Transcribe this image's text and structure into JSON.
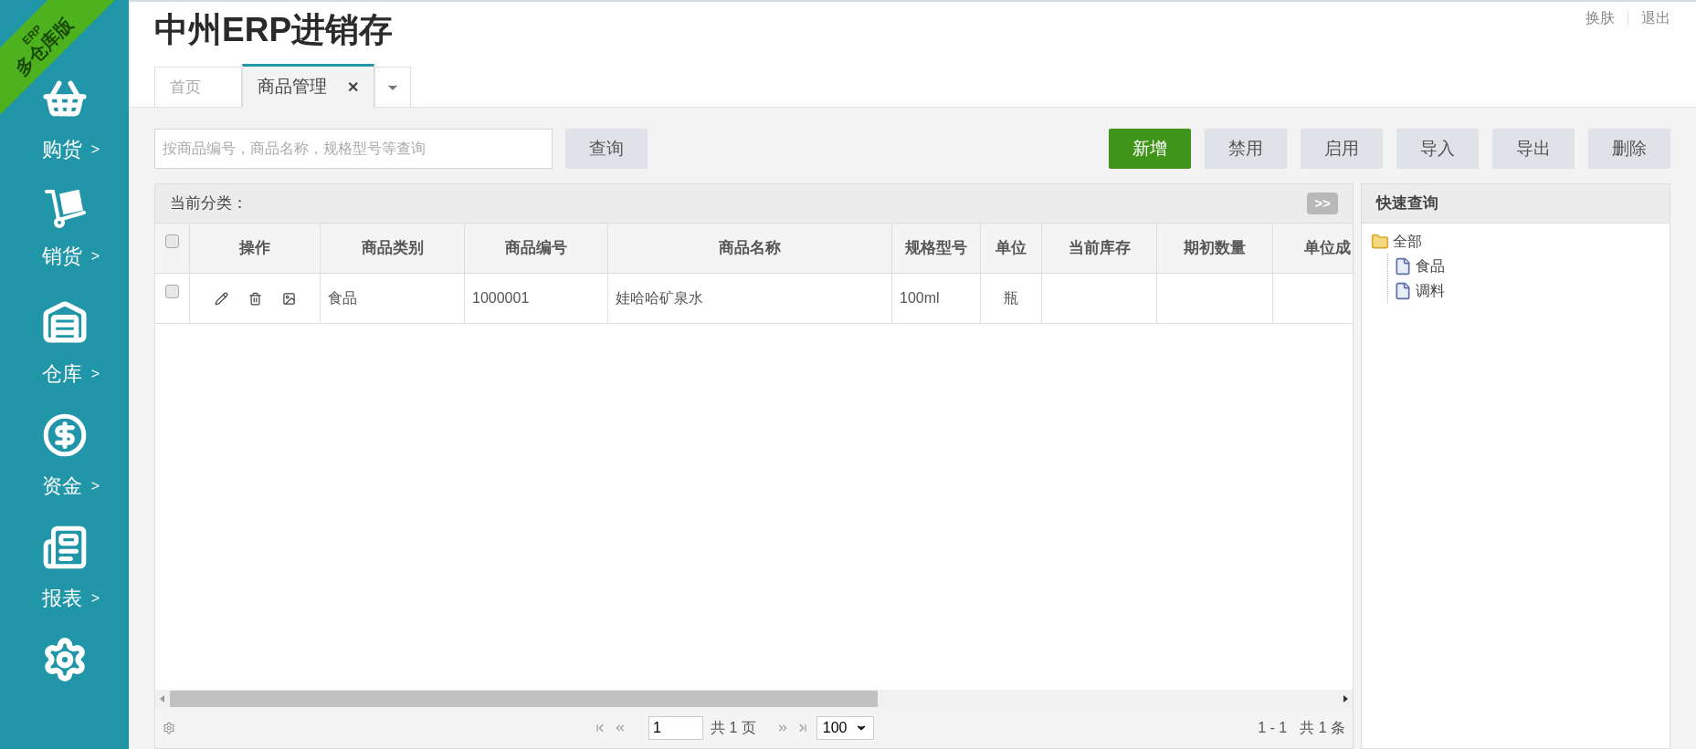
{
  "ribbon": {
    "small": "ERP",
    "large": "多仓库版"
  },
  "sidebar": {
    "items": [
      {
        "kind": "basket",
        "label": "购货",
        "arrow": ">"
      },
      {
        "kind": "cart",
        "label": "销货",
        "arrow": ">"
      },
      {
        "kind": "warehouse",
        "label": "仓库",
        "arrow": ">"
      },
      {
        "kind": "money",
        "label": "资金",
        "arrow": ">"
      },
      {
        "kind": "report",
        "label": "报表",
        "arrow": ">"
      },
      {
        "kind": "settings"
      }
    ]
  },
  "header": {
    "title": "中州ERP进销存",
    "links": [
      "换肤",
      "退出"
    ]
  },
  "tabs": [
    {
      "label": "首页",
      "selected": false,
      "closable": false
    },
    {
      "label": "商品管理",
      "selected": true,
      "closable": true
    }
  ],
  "tab_close": "✕",
  "search": {
    "placeholder": "按商品编号，商品名称，规格型号等查询",
    "button": "查询"
  },
  "toolbar": [
    {
      "label": "新增",
      "kind": "primary"
    },
    {
      "label": "禁用",
      "kind": "default"
    },
    {
      "label": "启用",
      "kind": "default"
    },
    {
      "label": "导入",
      "kind": "default"
    },
    {
      "label": "导出",
      "kind": "default"
    },
    {
      "label": "删除",
      "kind": "default"
    }
  ],
  "grid": {
    "category_label": "当前分类：",
    "expand_button": ">>",
    "header_checked": false,
    "action_header": "操作",
    "columns": [
      "商品类别",
      "商品编号",
      "商品名称",
      "规格型号",
      "单位",
      "当前库存",
      "期初数量",
      "单位成"
    ],
    "rows": [
      {
        "checked": false,
        "cells": [
          "食品",
          "1000001",
          "娃哈哈矿泉水",
          "100ml",
          "瓶",
          "",
          "",
          ""
        ]
      }
    ]
  },
  "pager": {
    "page": "1",
    "pages": "共 1 页",
    "page_size": "100",
    "range": "1 - 1",
    "total": "共 1 条"
  },
  "quick": {
    "title": "快速查询",
    "tree": [
      {
        "label": "全部",
        "children": [
          {
            "label": "食品"
          },
          {
            "label": "调料"
          }
        ]
      }
    ]
  }
}
